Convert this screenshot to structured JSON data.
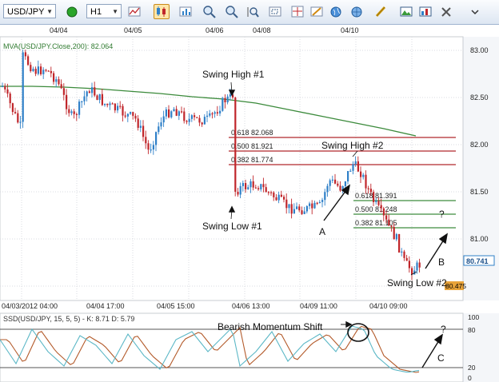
{
  "toolbar": {
    "symbol": "USD/JPY",
    "timeframe": "H1",
    "icons": [
      "green-circle-icon",
      "bar-chart-icon",
      "candlestick-icon",
      "line-chart-icon",
      "zoom-in-icon",
      "zoom-out-icon",
      "zoom-box-icon",
      "zoom-reset-icon",
      "crosshair-icon",
      "globe-icon",
      "ruler-icon",
      "image-icon",
      "settings-icon",
      "draw-tool-icon"
    ]
  },
  "price_chart": {
    "top_dates": [
      "04/04",
      "04/05",
      "04/06",
      "04/08",
      "04/10"
    ],
    "indicator_label": "MVA(USD/JPY.Close,200): 82.064",
    "y_ticks": [
      "83.00",
      "82.50",
      "82.00",
      "81.50",
      "81.00"
    ],
    "price_tag_last": "80.741",
    "price_tag_low": "80.475",
    "x_ticks": [
      "04/03/2012 04:00",
      "04/04 17:00",
      "04/05 15:00",
      "04/06 13:00",
      "04/09 11:00",
      "04/10 09:00"
    ],
    "fib_labels_1": [
      "0.618 82.068",
      "0.500 81.921",
      "0.382 81.774"
    ],
    "fib_labels_2": [
      "0.618 81.391",
      "0.500 81.248",
      "0.382 81.105"
    ],
    "annotations": {
      "swing_high_1": "Swing High #1",
      "swing_low_1": "Swing Low #1",
      "swing_high_2": "Swing High #2",
      "swing_low_2": "Swing Low #2",
      "a": "A",
      "b": "B",
      "question": "?"
    },
    "colors": {
      "up": "#2f80c8",
      "down": "#c0262b",
      "ma": "#3b8a3b",
      "fib_red": "#b0272c",
      "fib_green": "#3f8c3f"
    }
  },
  "oscillator": {
    "label": "SSD(USD/JPY, 15, 5, 5) - K: 8.71  D: 5.79",
    "y_ticks": [
      "100",
      "80",
      "20",
      "0"
    ],
    "annotations": {
      "bearish": "Bearish Momentum Shift",
      "c": "C",
      "question": "?"
    },
    "colors": {
      "k": "#5bb7c6",
      "d": "#b35a2a"
    }
  }
}
